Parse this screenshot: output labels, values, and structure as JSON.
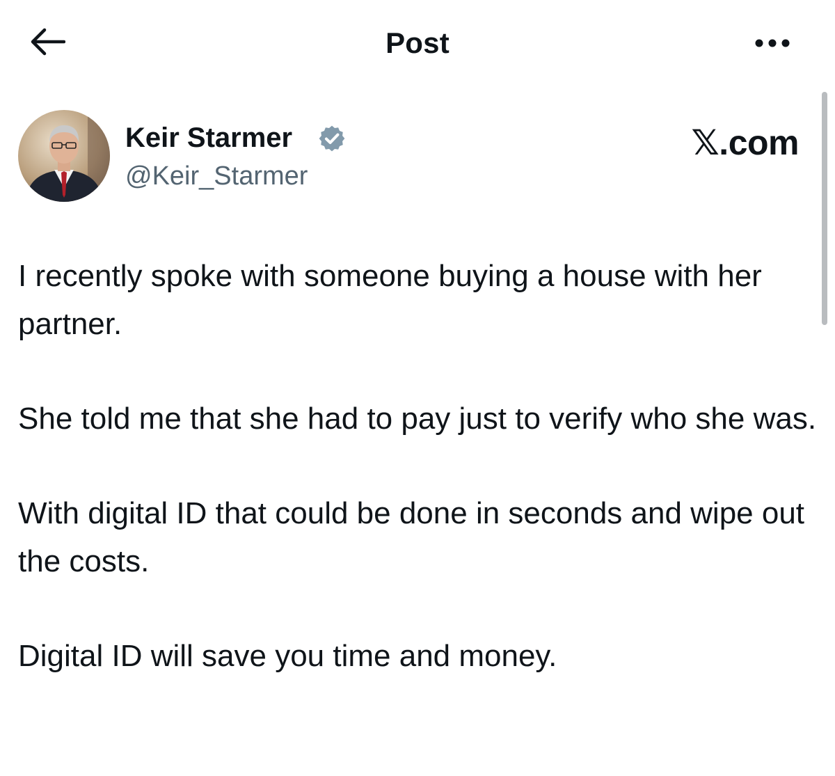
{
  "header": {
    "title": "Post",
    "back_icon": "arrow-left-icon",
    "more_icon": "more-horizontal-icon"
  },
  "author": {
    "name": "Keir Starmer",
    "handle": "@Keir_Starmer",
    "verified": true,
    "verified_icon": "verified-badge-icon",
    "badge_color": "#829aab"
  },
  "watermark": "𝕏.com",
  "post": {
    "paragraphs": [
      "I recently spoke with someone buying a house with her partner.",
      "She told me that she had to pay just to verify who she was.",
      "With digital ID that could be done in seconds and wipe out the costs.",
      "Digital ID will save you time and money."
    ]
  },
  "colors": {
    "text": "#0f1419",
    "secondary_text": "#536471",
    "scrollbar": "#b9bcbf"
  }
}
